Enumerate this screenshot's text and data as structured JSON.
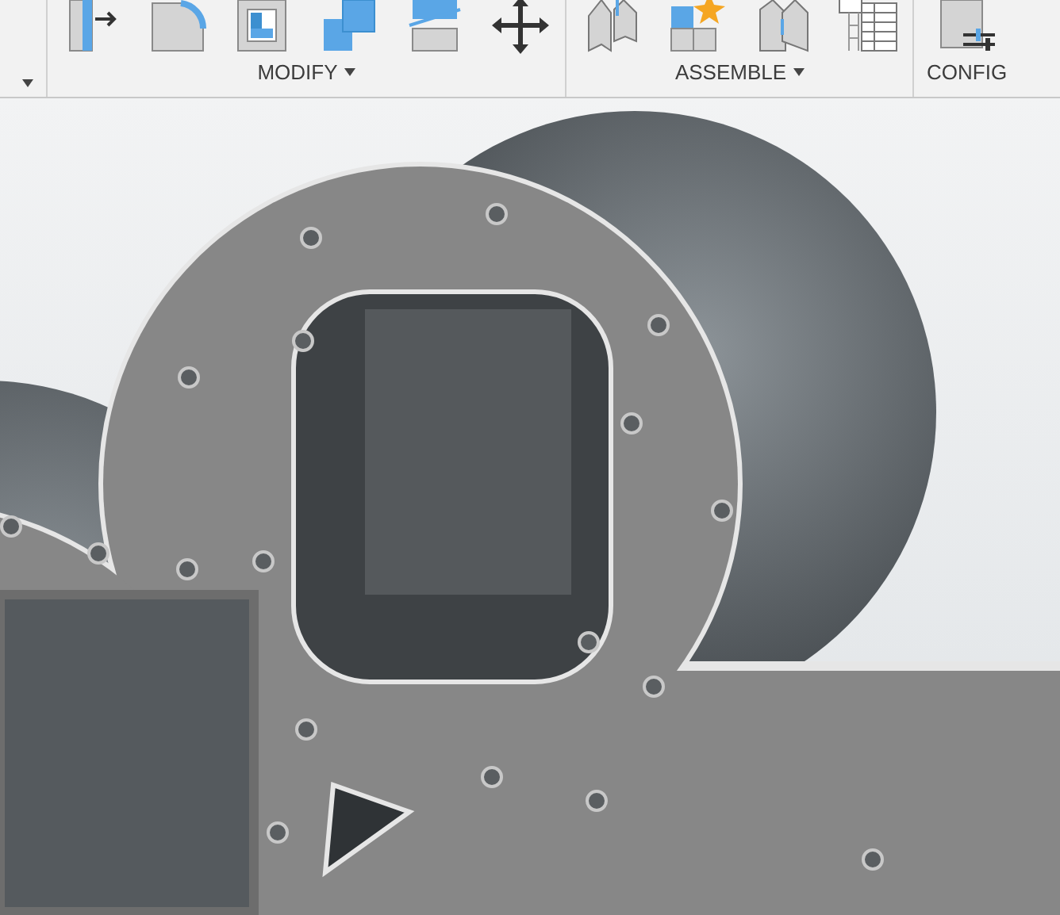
{
  "toolbar": {
    "groups": [
      {
        "dropdown": true
      },
      {
        "label": "MODIFY",
        "dropdown": true,
        "tools": [
          {
            "kind": "press-pull"
          },
          {
            "kind": "fillet"
          },
          {
            "kind": "shell"
          },
          {
            "kind": "combine"
          },
          {
            "kind": "offset-face"
          },
          {
            "kind": "move"
          }
        ]
      },
      {
        "label": "ASSEMBLE",
        "dropdown": true,
        "tools": [
          {
            "kind": "joint"
          },
          {
            "kind": "new-component"
          },
          {
            "kind": "as-built-joint"
          },
          {
            "kind": "table"
          }
        ]
      },
      {
        "label": "CONFIG",
        "dropdown": false,
        "tools": [
          {
            "kind": "configure"
          }
        ]
      }
    ]
  }
}
